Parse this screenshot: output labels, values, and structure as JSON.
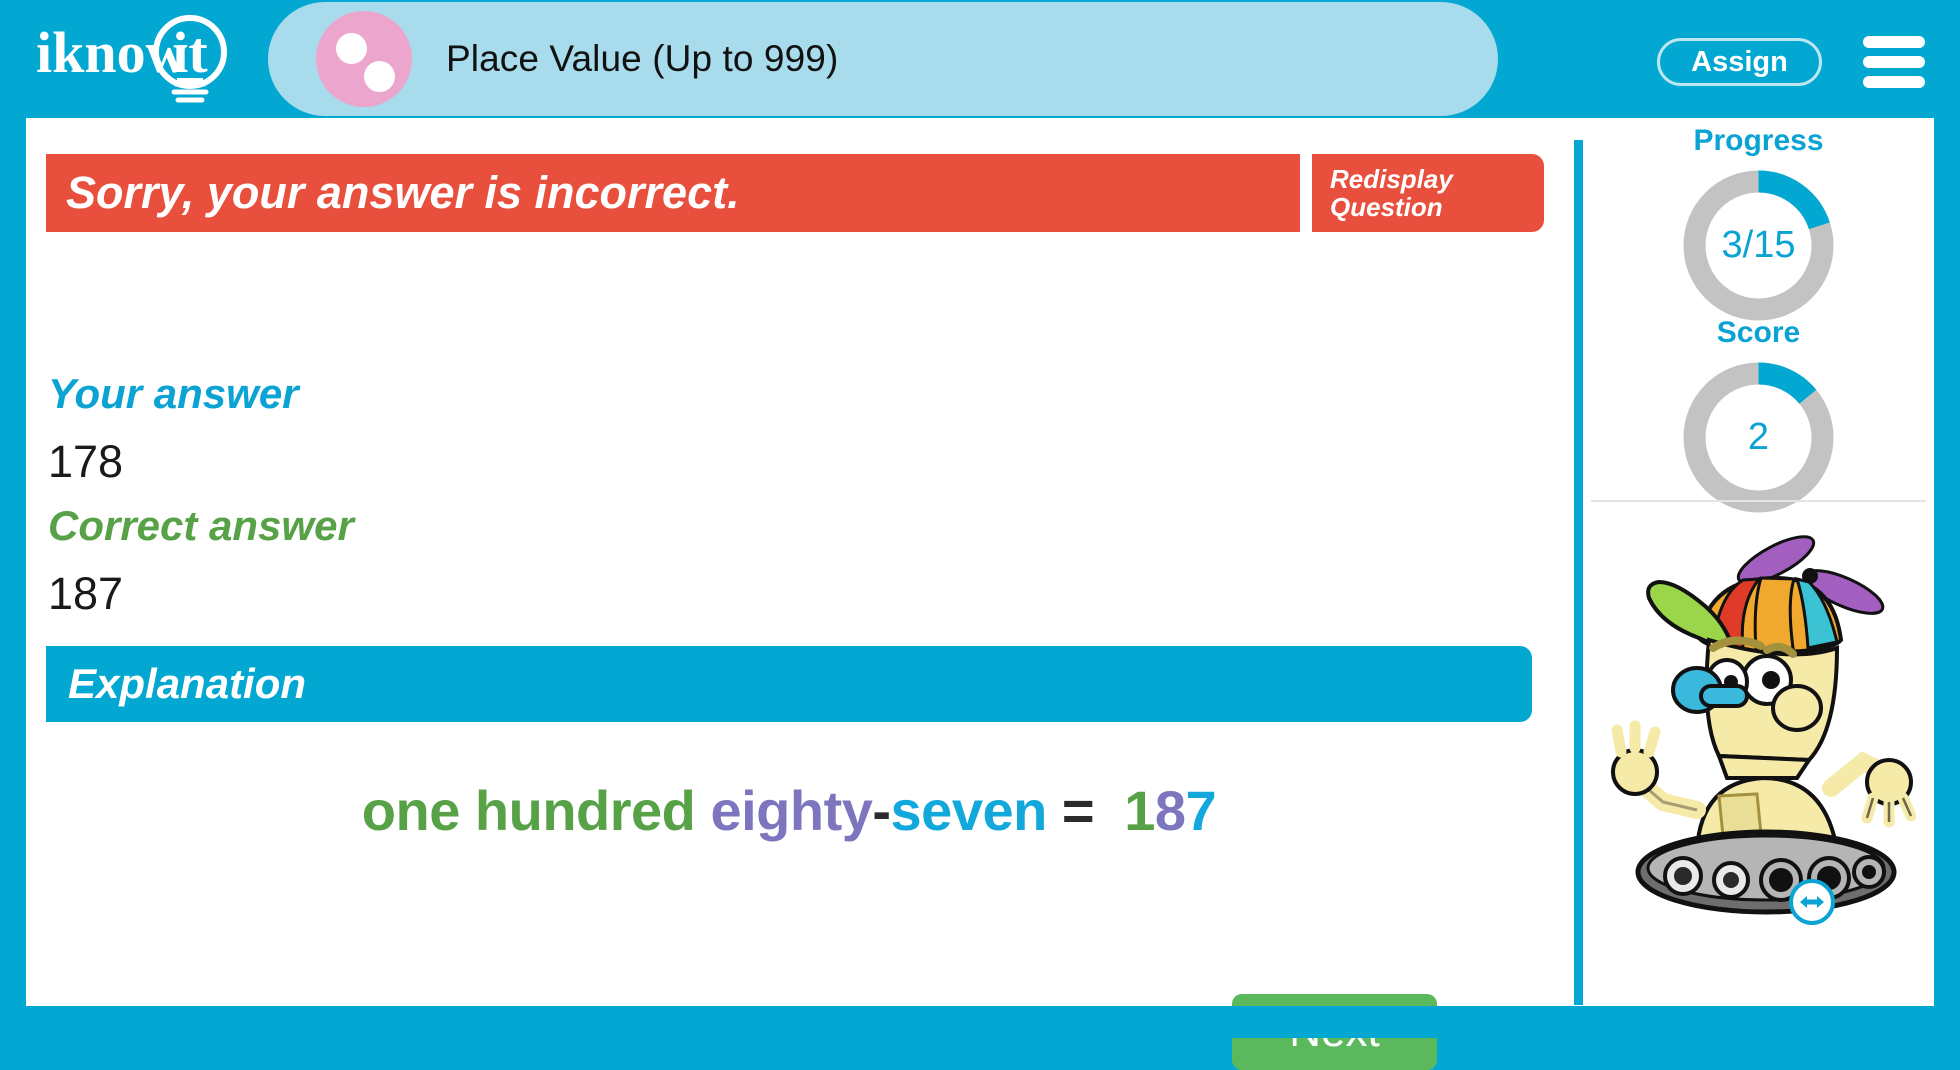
{
  "app": {
    "logo_text": "iknowit",
    "brand_color": "#02A8D1",
    "title_pill_color": "#A8DCEC"
  },
  "header": {
    "lesson_title": "Place Value (Up to 999)",
    "assign_label": "Assign",
    "menu_icon": "hamburger-icon",
    "lesson_icon": "pink-dots-icon"
  },
  "result": {
    "banner_text": "Sorry, your answer is incorrect.",
    "banner_color": "#E94F3D",
    "redisplay_line1": "Redisplay",
    "redisplay_line2": "Question"
  },
  "answers": {
    "your_answer_label": "Your answer",
    "your_answer_value": "178",
    "your_answer_color": "#0BA3D4",
    "correct_answer_label": "Correct answer",
    "correct_answer_value": "187",
    "correct_answer_color": "#57A147"
  },
  "explanation": {
    "header": "Explanation",
    "header_color": "#02A8D1",
    "equation_parts": [
      {
        "text": "one hundred",
        "color": "#57A147"
      },
      {
        "text": "eighty",
        "color": "#7D76BE"
      },
      {
        "text": "-",
        "color": "#2b2b2b"
      },
      {
        "text": "seven",
        "color": "#12A8DC"
      },
      {
        "text": "=",
        "color": "#2b2b2b"
      },
      {
        "text": "1",
        "color": "#57A147"
      },
      {
        "text": "8",
        "color": "#7D76BE"
      },
      {
        "text": "7",
        "color": "#12A8DC"
      }
    ],
    "equation_plain": "one hundred eighty-seven = 187"
  },
  "actions": {
    "next_label": "Next",
    "next_color": "#5CB85C"
  },
  "sidebar": {
    "progress": {
      "title": "Progress",
      "value_text": "3/15",
      "current": 3,
      "total": 15,
      "percent": 20,
      "arc_color": "#02A8D1",
      "track_color": "#C3C3C3"
    },
    "score": {
      "title": "Score",
      "value_text": "2",
      "current": 2,
      "percent": 14,
      "arc_color": "#02A8D1",
      "track_color": "#C3C3C3"
    },
    "mascot": {
      "name": "robot-mascot",
      "resize_icon": "left-right-arrows-icon"
    }
  }
}
